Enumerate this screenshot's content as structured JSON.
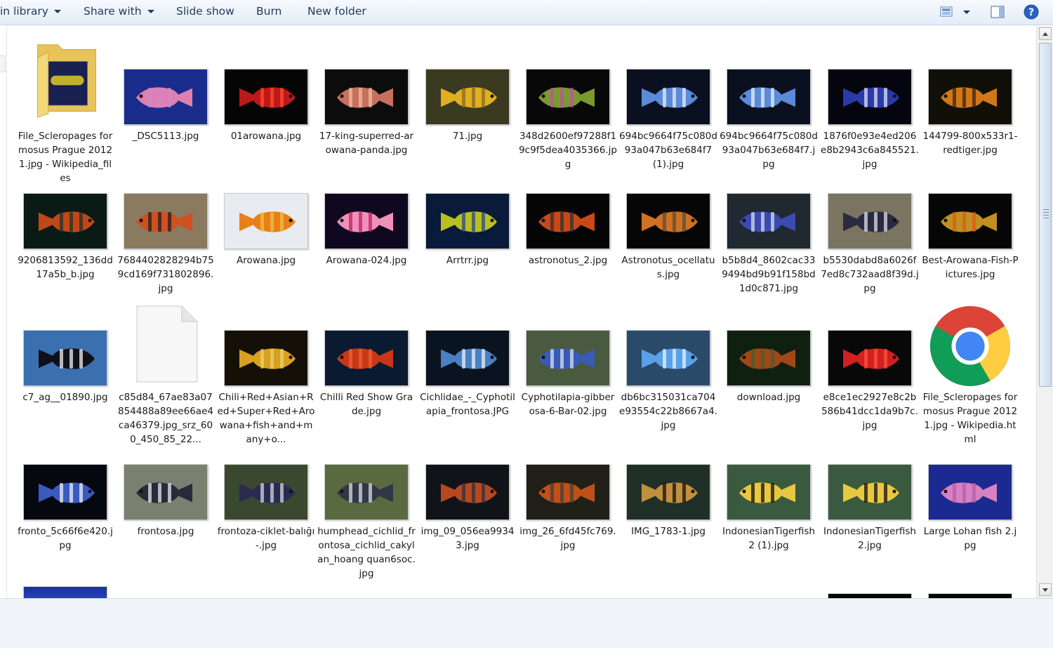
{
  "toolbar": {
    "items": [
      {
        "label": "in library",
        "has_arrow": true
      },
      {
        "label": "Share with",
        "has_arrow": true
      },
      {
        "label": "Slide show",
        "has_arrow": false
      },
      {
        "label": "Burn",
        "has_arrow": false
      },
      {
        "label": "New folder",
        "has_arrow": false
      }
    ],
    "right_icons": [
      "change-view-icon",
      "view-options-arrow-icon",
      "preview-pane-icon",
      "help-icon"
    ]
  },
  "files": [
    {
      "name": "File_Scleropages formosus Prague 2012 1.jpg - Wikipedia_files",
      "kind": "folder"
    },
    {
      "name": "_DSC5113.jpg",
      "kind": "image",
      "palette": [
        "#1a2d8c",
        "#e07fb0",
        "#c98ad0"
      ]
    },
    {
      "name": "01arowana.jpg",
      "kind": "image",
      "palette": [
        "#050505",
        "#c01818",
        "#ff4a30"
      ]
    },
    {
      "name": "17-king-superred-arowana-panda.jpg",
      "kind": "image",
      "palette": [
        "#0c0c0c",
        "#c87060",
        "#e8c0a0"
      ]
    },
    {
      "name": "71.jpg",
      "kind": "image",
      "palette": [
        "#3a3a20",
        "#e0b020",
        "#8a6a20"
      ]
    },
    {
      "name": "348d2600ef97288f19c9f5dea4035366.jpg",
      "kind": "image",
      "palette": [
        "#080808",
        "#7a9a30",
        "#c050a0"
      ]
    },
    {
      "name": "694bc9664f75c080d93a047b63e684f7 (1).jpg",
      "kind": "image",
      "palette": [
        "#0a1020",
        "#5a8ad8",
        "#e8eef8"
      ]
    },
    {
      "name": "694bc9664f75c080d93a047b63e684f7.jpg",
      "kind": "image",
      "palette": [
        "#0a1020",
        "#5a8ad8",
        "#e8eef8"
      ]
    },
    {
      "name": "1876f0e93e4ed206e8b2943c6a845521.jpg",
      "kind": "image",
      "palette": [
        "#050510",
        "#2a3aa8",
        "#e0e0f0"
      ]
    },
    {
      "name": "144799-800x533r1-redtiger.jpg",
      "kind": "image",
      "palette": [
        "#101008",
        "#d07818",
        "#402010"
      ]
    },
    {
      "name": "9206813592_136dd17a5b_b.jpg",
      "kind": "image",
      "palette": [
        "#0a1a14",
        "#c04818",
        "#203028"
      ]
    },
    {
      "name": "7684402828294b759cd169f731802896.jpg",
      "kind": "image",
      "palette": [
        "#8a7a60",
        "#d05020",
        "#202020"
      ]
    },
    {
      "name": "Arowana.jpg",
      "kind": "image",
      "palette": [
        "#e8ecf0",
        "#e88018",
        "#f0c040"
      ]
    },
    {
      "name": "Arowana-024.jpg",
      "kind": "image",
      "palette": [
        "#100820",
        "#f090b8",
        "#c02060"
      ]
    },
    {
      "name": "Arrtrr.jpg",
      "kind": "image",
      "palette": [
        "#0a1a3a",
        "#b8c020",
        "#2a4a8a"
      ]
    },
    {
      "name": "astronotus_2.jpg",
      "kind": "image",
      "palette": [
        "#050505",
        "#c84818",
        "#303030"
      ]
    },
    {
      "name": "Astronotus_ocellatus.jpg",
      "kind": "image",
      "palette": [
        "#060606",
        "#d07020",
        "#505040"
      ]
    },
    {
      "name": "b5b8d4_8602cac339494bd9b91f158bd1d0c871.jpg",
      "kind": "image",
      "palette": [
        "#202830",
        "#3a4ab0",
        "#d8dce8"
      ]
    },
    {
      "name": "b5530dabd8a6026f7ed8c732aad8f39d.jpg",
      "kind": "image",
      "palette": [
        "#7a7460",
        "#2a2a40",
        "#e0e0e8"
      ]
    },
    {
      "name": "Best-Arowana-Fish-Pictures.jpg",
      "kind": "image",
      "palette": [
        "#060606",
        "#c09020",
        "#e05818"
      ]
    },
    {
      "name": "c7_ag__01890.jpg",
      "kind": "image",
      "palette": [
        "#3a70b0",
        "#101018",
        "#f0f0f0"
      ]
    },
    {
      "name": "c85d84_67ae83a07854488a89ee66ae4ca46379.jpg_srz_600_450_85_22...",
      "kind": "document"
    },
    {
      "name": "Chili+Red+Asian+Red+Super+Red+Arowana+fish+and+many+o...",
      "kind": "image",
      "palette": [
        "#141008",
        "#d8a020",
        "#f0d060"
      ]
    },
    {
      "name": "Chilli Red Show Grade.jpg",
      "kind": "image",
      "palette": [
        "#0a1a30",
        "#c83818",
        "#f06030"
      ]
    },
    {
      "name": "Cichlidae_-_Cyphotilapia_frontosa.JPG",
      "kind": "image",
      "palette": [
        "#0a1420",
        "#4a80c0",
        "#e8f0f8"
      ]
    },
    {
      "name": "Cyphotilapia-gibberosa-6-Bar-02.jpg",
      "kind": "image",
      "palette": [
        "#4a5a40",
        "#3a5ab8",
        "#d8e0f0"
      ]
    },
    {
      "name": "db6bc315031ca704e93554c22b8667a4.jpg",
      "kind": "image",
      "palette": [
        "#2a4a6a",
        "#5aa0e8",
        "#e8f4ff"
      ]
    },
    {
      "name": "download.jpg",
      "kind": "image",
      "palette": [
        "#102010",
        "#a04818",
        "#406030"
      ]
    },
    {
      "name": "e8ce1ec2927e8c2b586b41dcc1da9b7c.jpg",
      "kind": "image",
      "palette": [
        "#080808",
        "#d02020",
        "#ff5040"
      ]
    },
    {
      "name": "File_Scleropages formosus Prague 2012 1.jpg - Wikipedia.html",
      "kind": "chrome"
    },
    {
      "name": "fronto_5c66f6e420.jpg",
      "kind": "image",
      "palette": [
        "#060810",
        "#3a5ac0",
        "#f0f0f8"
      ]
    },
    {
      "name": "frontosa.jpg",
      "kind": "image",
      "palette": [
        "#7a8070",
        "#2a2a3a",
        "#e8e8f0"
      ]
    },
    {
      "name": "frontoza-ciklet-balığı-.jpg",
      "kind": "image",
      "palette": [
        "#3a4830",
        "#2a2a50",
        "#d0d4e0"
      ]
    },
    {
      "name": "humphead_cichlid_frontosa_cichlid_cakylan_hoang quan6soc.jpg",
      "kind": "image",
      "palette": [
        "#5a6a40",
        "#303848",
        "#d8dce0"
      ]
    },
    {
      "name": "img_09_056ea99343.jpg",
      "kind": "image",
      "palette": [
        "#101418",
        "#b84820",
        "#303038"
      ]
    },
    {
      "name": "img_26_6fd45fc769.jpg",
      "kind": "image",
      "palette": [
        "#202018",
        "#c05018",
        "#404038"
      ]
    },
    {
      "name": "IMG_1783-1.jpg",
      "kind": "image",
      "palette": [
        "#203028",
        "#c09040",
        "#101010"
      ]
    },
    {
      "name": "IndonesianTigerfish2 (1).jpg",
      "kind": "image",
      "palette": [
        "#3a5a40",
        "#e8c840",
        "#101010"
      ]
    },
    {
      "name": "IndonesianTigerfish2.jpg",
      "kind": "image",
      "palette": [
        "#3a5a40",
        "#e8c840",
        "#101010"
      ]
    },
    {
      "name": "Large Lohan fish 2.jpg",
      "kind": "image",
      "palette": [
        "#1a2a90",
        "#d880c0",
        "#b060b0"
      ]
    }
  ],
  "partial_row": [
    {
      "palette": [
        "#1a30a0",
        "#3050d0"
      ]
    },
    {
      "palette": [
        "#050505",
        "#101010"
      ]
    },
    {
      "palette": [
        "#050505",
        "#101010"
      ]
    },
    {
      "palette": [
        "#050505",
        "#101010"
      ]
    }
  ]
}
